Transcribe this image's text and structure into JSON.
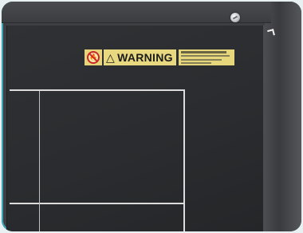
{
  "label": {
    "warning": "WARNING",
    "icons": {
      "hazard": "no-open-flame-icon",
      "alert": "warning-triangle-icon"
    }
  },
  "colors": {
    "device_body": "#3d3f42",
    "bed": "#2a2c2f",
    "label_yellow": "#e8d981",
    "frame_accent": "#3aa4b4"
  }
}
